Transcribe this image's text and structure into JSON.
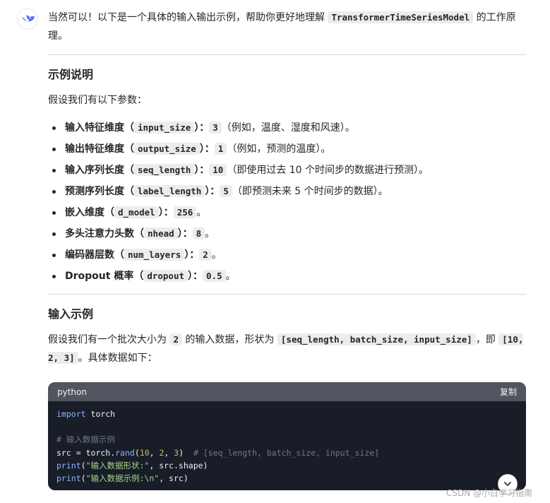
{
  "intro": {
    "pre": "当然可以！以下是一个具体的输入输出示例，帮助你更好地理解 ",
    "code": "TransformerTimeSeriesModel",
    "post": " 的工作原理。"
  },
  "section1": {
    "title": "示例说明",
    "lead": "假设我们有以下参数：",
    "items": [
      {
        "label": "输入特征维度（",
        "code": "input_size",
        "sep": "）：",
        "value": "3",
        "note": "（例如，温度、湿度和风速）。"
      },
      {
        "label": "输出特征维度（",
        "code": "output_size",
        "sep": "）：",
        "value": "1",
        "note": "（例如，预测的温度）。"
      },
      {
        "label": "输入序列长度（",
        "code": "seq_length",
        "sep": "）：",
        "value": "10",
        "note": "（即使用过去 10 个时间步的数据进行预测）。"
      },
      {
        "label": "预测序列长度（",
        "code": "label_length",
        "sep": "）：",
        "value": "5",
        "note": "（即预测未来 5 个时间步的数据）。"
      },
      {
        "label": "嵌入维度（",
        "code": "d_model",
        "sep": "）：",
        "value": "256",
        "note": "。"
      },
      {
        "label": "多头注意力头数（",
        "code": "nhead",
        "sep": "）：",
        "value": "8",
        "note": "。"
      },
      {
        "label": "编码器层数（",
        "code": "num_layers",
        "sep": "）：",
        "value": "2",
        "note": "。"
      },
      {
        "label": "Dropout 概率（",
        "code": "dropout",
        "sep": "）：",
        "value": "0.5",
        "note": "。"
      }
    ]
  },
  "section2": {
    "title": "输入示例",
    "p1": "假设我们有一个批次大小为 ",
    "c1": "2",
    "p2": " 的输入数据，形状为 ",
    "c2": "[seq_length, batch_size, input_size]",
    "p3": "，即 ",
    "c3": "[10, 2, 3]",
    "p4": "。具体数据如下："
  },
  "code": {
    "language": "python",
    "copy_label": "复制",
    "lines": {
      "l1a": "import",
      "l1b": " torch",
      "l3": "# 输入数据示例",
      "l4a": "src",
      "l4b": " = ",
      "l4c": "torch",
      "l4d": ".",
      "l4e": "rand",
      "l4f": "(",
      "l4g": "10",
      "l4h": ", ",
      "l4i": "2",
      "l4j": ", ",
      "l4k": "3",
      "l4l": ")  ",
      "l4m": "# [seq_length, batch_size, input_size]",
      "l5a": "print",
      "l5b": "(",
      "l5c": "\"输入数据形状:\"",
      "l5d": ", ",
      "l5e": "src",
      "l5f": ".",
      "l5g": "shape",
      "l5h": ")",
      "l6a": "print",
      "l6b": "(",
      "l6c": "\"输入数据示例:\\n\"",
      "l6d": ", ",
      "l6e": "src",
      "l6f": ")"
    }
  },
  "watermark": "CSDN @小白学习指南",
  "icons": {
    "avatar": "deepseek-whale-icon",
    "scroll": "chevron-down-icon"
  },
  "colors": {
    "accent": "#4d6bfe",
    "code_bg": "#181d28",
    "code_header": "#50555f"
  }
}
